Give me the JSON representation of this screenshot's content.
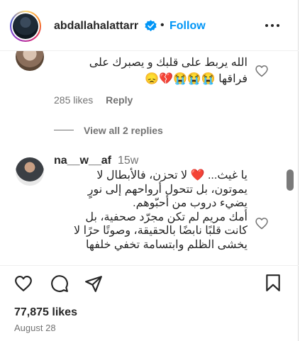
{
  "header": {
    "username": "abdallahalattarr",
    "separator": "•",
    "follow_label": "Follow",
    "verified_icon": "verified-badge-icon",
    "more_icon": "more-options-icon",
    "colors": {
      "follow": "#0095f6",
      "verified": "#0095f6"
    }
  },
  "comment1": {
    "line1": "الله يربط على قلبك و يصبرك على",
    "line2": "فراقها 😭😭😭💔😞",
    "likes": "285 likes",
    "reply_label": "Reply"
  },
  "replies": {
    "view_label": "View all 2 replies"
  },
  "comment2": {
    "username": "na__w__af",
    "time": "15w",
    "lines": [
      "يا غيث... ❤️ لا تحزن، فالأبطال لا",
      "يموتون، بل تتحول أرواحهم إلى نورٍ",
      "يضيء دروب من أحبّوهم.",
      "أمك مريم لم تكن مجرّد صحفية، بل",
      "كانت قلبًا نابضًا بالحقيقة، وصوتًا حرًا لا",
      "يخشى الظلم وابتسامة تخفي خلفها"
    ]
  },
  "footer": {
    "likes": "77,875 likes",
    "date": "August 28"
  }
}
